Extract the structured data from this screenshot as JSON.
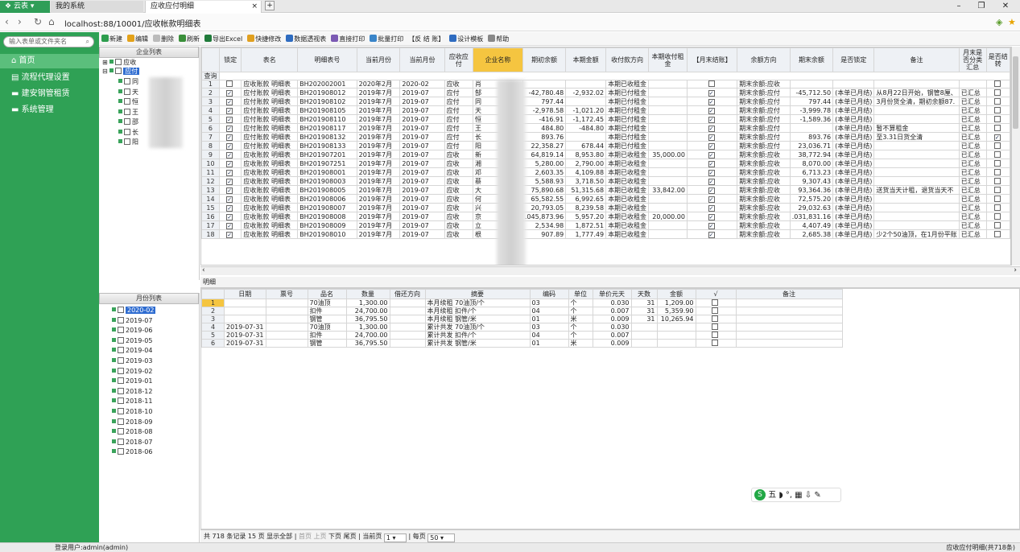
{
  "browser": {
    "tab_app": "云表",
    "tab_system": "我的系统",
    "tab_active": "应收应付明细",
    "url": "localhost:88/10001/应收帐款明细表"
  },
  "sidebar": {
    "search_placeholder": "输入表单或文件夹名",
    "items": [
      {
        "label": "首页"
      },
      {
        "label": "流程代理设置"
      },
      {
        "label": "建安钢管租赁"
      },
      {
        "label": "系统管理"
      }
    ]
  },
  "toolbar": [
    {
      "label": "新建",
      "color": "#2e9e4e"
    },
    {
      "label": "编辑",
      "color": "#e3a21a"
    },
    {
      "label": "删除",
      "color": "#bbbbbb"
    },
    {
      "label": "刷新",
      "color": "#3a8f3a"
    },
    {
      "label": "导出Excel",
      "color": "#1f7a3a"
    },
    {
      "label": "快捷修改",
      "color": "#e0a020"
    },
    {
      "label": "数据透视表",
      "color": "#2f6cc0"
    },
    {
      "label": "直接打印",
      "color": "#7b5ab3"
    },
    {
      "label": "批量打印",
      "color": "#3a85c9"
    },
    {
      "label": "【反 结 账】",
      "color": ""
    },
    {
      "label": "设计模板",
      "color": "#2f6cc0"
    },
    {
      "label": "帮助",
      "color": "#888888"
    }
  ],
  "company_tree": {
    "title": "企业列表",
    "roots": [
      {
        "label": "应收",
        "checked": false
      },
      {
        "label": "应付",
        "checked": false,
        "selected": true
      }
    ],
    "children": [
      "同",
      "天",
      "恒",
      "王",
      "邵",
      "长",
      "阳"
    ]
  },
  "month_list": {
    "title": "月份列表",
    "months": [
      "2020-02",
      "2019-07",
      "2019-06",
      "2019-05",
      "2019-04",
      "2019-03",
      "2019-02",
      "2019-01",
      "2018-12",
      "2018-11",
      "2018-10",
      "2018-09",
      "2018-08",
      "2018-07",
      "2018-06"
    ]
  },
  "grid": {
    "query_label": "查询",
    "columns": [
      "锁定",
      "表名",
      "明细表号",
      "当前月份",
      "当前月份",
      "应收应付",
      "企业名称",
      "期初余额",
      "本期金额",
      "收付款方向",
      "本期收付租金",
      "【月末结账】",
      "余额方向",
      "期末余额",
      "是否锁定",
      "备注",
      "月末是否分类汇总",
      "是否结转"
    ],
    "rows": [
      {
        "n": "1",
        "lock": false,
        "tbl": "应收账款 明细表",
        "no": "BH202002001",
        "m1": "2020年2月",
        "m2": "2020-02",
        "type": "应收",
        "co": "肖",
        "open": "",
        "amt": "",
        "dir": "本期已收租金",
        "rent": "",
        "close": false,
        "bdir": "期末余额:应收",
        "end": "",
        "locked": "",
        "note": "",
        "sum": "",
        "carry": false
      },
      {
        "n": "2",
        "lock": true,
        "tbl": "应付账款 明细表",
        "no": "BH201908012",
        "m1": "2019年7月",
        "m2": "2019-07",
        "type": "应付",
        "co": "郜",
        "open": "-42,780.48",
        "amt": "-2,932.02",
        "dir": "本期已付租金",
        "rent": "",
        "close": true,
        "bdir": "期末余额:应付",
        "end": "-45,712.50",
        "locked": "(本单已月结)",
        "note": "从8月22日开始，钢管8厘、",
        "sum": "已汇总",
        "carry": false
      },
      {
        "n": "3",
        "lock": true,
        "tbl": "应付账款 明细表",
        "no": "BH201908102",
        "m1": "2019年7月",
        "m2": "2019-07",
        "type": "应付",
        "co": "同",
        "open": "797.44",
        "amt": "",
        "dir": "本期已付租金",
        "rent": "",
        "close": true,
        "bdir": "期末余额:应付",
        "end": "797.44",
        "locked": "(本单已月结)",
        "note": "3月份货全清，期初余额87.",
        "sum": "已汇总",
        "carry": false
      },
      {
        "n": "4",
        "lock": true,
        "tbl": "应付账款 明细表",
        "no": "BH201908105",
        "m1": "2019年7月",
        "m2": "2019-07",
        "type": "应付",
        "co": "天",
        "open": "-2,978.58",
        "amt": "-1,021.20",
        "dir": "本期已付租金",
        "rent": "",
        "close": true,
        "bdir": "期末余额:应付",
        "end": "-3,999.78",
        "locked": "(本单已月结)",
        "note": "",
        "sum": "已汇总",
        "carry": false
      },
      {
        "n": "5",
        "lock": true,
        "tbl": "应付账款 明细表",
        "no": "BH201908110",
        "m1": "2019年7月",
        "m2": "2019-07",
        "type": "应付",
        "co": "恒",
        "open": "-416.91",
        "amt": "-1,172.45",
        "dir": "本期已付租金",
        "rent": "",
        "close": true,
        "bdir": "期末余额:应付",
        "end": "-1,589.36",
        "locked": "(本单已月结)",
        "note": "",
        "sum": "已汇总",
        "carry": false
      },
      {
        "n": "6",
        "lock": true,
        "tbl": "应付账款 明细表",
        "no": "BH201908117",
        "m1": "2019年7月",
        "m2": "2019-07",
        "type": "应付",
        "co": "王",
        "open": "484.80",
        "amt": "-484.80",
        "dir": "本期已付租金",
        "rent": "",
        "close": true,
        "bdir": "期末余额:应付",
        "end": "",
        "locked": "(本单已月结)",
        "note": "暂不算租金",
        "sum": "已汇总",
        "carry": false
      },
      {
        "n": "7",
        "lock": true,
        "tbl": "应付账款 明细表",
        "no": "BH201908132",
        "m1": "2019年7月",
        "m2": "2019-07",
        "type": "应付",
        "co": "长",
        "open": "893.76",
        "amt": "",
        "dir": "本期已付租金",
        "rent": "",
        "close": true,
        "bdir": "期末余额:应付",
        "end": "893.76",
        "locked": "(本单已月结)",
        "note": "至3.31日货全清",
        "sum": "已汇总",
        "carry": true
      },
      {
        "n": "8",
        "lock": true,
        "tbl": "应付账款 明细表",
        "no": "BH201908133",
        "m1": "2019年7月",
        "m2": "2019-07",
        "type": "应付",
        "co": "阳",
        "open": "22,358.27",
        "amt": "678.44",
        "dir": "本期已付租金",
        "rent": "",
        "close": true,
        "bdir": "期末余额:应付",
        "end": "23,036.71",
        "locked": "(本单已月结)",
        "note": "",
        "sum": "已汇总",
        "carry": false
      },
      {
        "n": "9",
        "lock": true,
        "tbl": "应收账款 明细表",
        "no": "BH201907201",
        "m1": "2019年7月",
        "m2": "2019-07",
        "type": "应收",
        "co": "新",
        "open": "64,819.14",
        "amt": "8,953.80",
        "dir": "本期已收租金",
        "rent": "35,000.00",
        "close": true,
        "bdir": "期末余额:应收",
        "end": "38,772.94",
        "locked": "(本单已月结)",
        "note": "",
        "sum": "已汇总",
        "carry": false
      },
      {
        "n": "10",
        "lock": true,
        "tbl": "应收账款 明细表",
        "no": "BH201907251",
        "m1": "2019年7月",
        "m2": "2019-07",
        "type": "应收",
        "co": "湘",
        "open": "5,280.00",
        "amt": "2,790.00",
        "dir": "本期已收租金",
        "rent": "",
        "close": true,
        "bdir": "期末余额:应收",
        "end": "8,070.00",
        "locked": "(本单已月结)",
        "note": "",
        "sum": "已汇总",
        "carry": false
      },
      {
        "n": "11",
        "lock": true,
        "tbl": "应收账款 明细表",
        "no": "BH201908001",
        "m1": "2019年7月",
        "m2": "2019-07",
        "type": "应收",
        "co": "邓",
        "open": "2,603.35",
        "amt": "4,109.88",
        "dir": "本期已收租金",
        "rent": "",
        "close": true,
        "bdir": "期末余额:应收",
        "end": "6,713.23",
        "locked": "(本单已月结)",
        "note": "",
        "sum": "已汇总",
        "carry": false
      },
      {
        "n": "12",
        "lock": true,
        "tbl": "应收账款 明细表",
        "no": "BH201908003",
        "m1": "2019年7月",
        "m2": "2019-07",
        "type": "应收",
        "co": "蔡",
        "open": "5,588.93",
        "amt": "3,718.50",
        "dir": "本期已收租金",
        "rent": "",
        "close": true,
        "bdir": "期末余额:应收",
        "end": "9,307.43",
        "locked": "(本单已月结)",
        "note": "",
        "sum": "已汇总",
        "carry": false
      },
      {
        "n": "13",
        "lock": true,
        "tbl": "应收账款 明细表",
        "no": "BH201908005",
        "m1": "2019年7月",
        "m2": "2019-07",
        "type": "应收",
        "co": "大",
        "open": "75,890.68",
        "amt": "51,315.68",
        "dir": "本期已收租金",
        "rent": "33,842.00",
        "close": true,
        "bdir": "期末余额:应收",
        "end": "93,364.36",
        "locked": "(本单已月结)",
        "note": "送货当天计租，退货当天不",
        "sum": "已汇总",
        "carry": false
      },
      {
        "n": "14",
        "lock": true,
        "tbl": "应收账款 明细表",
        "no": "BH201908006",
        "m1": "2019年7月",
        "m2": "2019-07",
        "type": "应收",
        "co": "何",
        "open": "65,582.55",
        "amt": "6,992.65",
        "dir": "本期已收租金",
        "rent": "",
        "close": true,
        "bdir": "期末余额:应收",
        "end": "72,575.20",
        "locked": "(本单已月结)",
        "note": "",
        "sum": "已汇总",
        "carry": false
      },
      {
        "n": "15",
        "lock": true,
        "tbl": "应收账款 明细表",
        "no": "BH201908007",
        "m1": "2019年7月",
        "m2": "2019-07",
        "type": "应收",
        "co": "兴",
        "open": "20,793.05",
        "amt": "8,239.58",
        "dir": "本期已收租金",
        "rent": "",
        "close": true,
        "bdir": "期末余额:应收",
        "end": "29,032.63",
        "locked": "(本单已月结)",
        "note": "",
        "sum": "已汇总",
        "carry": false
      },
      {
        "n": "16",
        "lock": true,
        "tbl": "应收账款 明细表",
        "no": "BH201908008",
        "m1": "2019年7月",
        "m2": "2019-07",
        "type": "应收",
        "co": "京",
        "open": ".045,873.96",
        "amt": "5,957.20",
        "dir": "本期已收租金",
        "rent": "20,000.00",
        "close": true,
        "bdir": "期末余额:应收",
        "end": ".031,831.16",
        "locked": "(本单已月结)",
        "note": "",
        "sum": "已汇总",
        "carry": false
      },
      {
        "n": "17",
        "lock": true,
        "tbl": "应收账款 明细表",
        "no": "BH201908009",
        "m1": "2019年7月",
        "m2": "2019-07",
        "type": "应收",
        "co": "立",
        "open": "2,534.98",
        "amt": "1,872.51",
        "dir": "本期已收租金",
        "rent": "",
        "close": true,
        "bdir": "期末余额:应收",
        "end": "4,407.49",
        "locked": "(本单已月结)",
        "note": "",
        "sum": "已汇总",
        "carry": false
      },
      {
        "n": "18",
        "lock": true,
        "tbl": "应收账款 明细表",
        "no": "BH201908010",
        "m1": "2019年7月",
        "m2": "2019-07",
        "type": "应收",
        "co": "根",
        "open": "907.89",
        "amt": "1,777.49",
        "dir": "本期已收租金",
        "rent": "",
        "close": true,
        "bdir": "期末余额:应收",
        "end": "2,685.38",
        "locked": "(本单已月结)",
        "note": "少2个50油顶，在1月份平账",
        "sum": "已汇总",
        "carry": false
      }
    ]
  },
  "detail": {
    "tab_label": "明细",
    "columns": [
      "日期",
      "票号",
      "品名",
      "数量",
      "借还方向",
      "摘要",
      "编码",
      "单位",
      "单价元天",
      "天数",
      "金额",
      "√",
      "备注"
    ],
    "rows": [
      {
        "n": "1",
        "date": "",
        "ticket": "",
        "name": "70油顶",
        "qty": "1,300.00",
        "dirn": "",
        "memo": "本月续租 70油顶/个",
        "code": "03",
        "unit": "个",
        "price": "0.030",
        "days": "31",
        "amt": "1,209.00",
        "chk": false,
        "note": ""
      },
      {
        "n": "2",
        "date": "",
        "ticket": "",
        "name": "扣件",
        "qty": "24,700.00",
        "dirn": "",
        "memo": "本月续租 扣件/个",
        "code": "04",
        "unit": "个",
        "price": "0.007",
        "days": "31",
        "amt": "5,359.90",
        "chk": false,
        "note": ""
      },
      {
        "n": "3",
        "date": "",
        "ticket": "",
        "name": "钢管",
        "qty": "36,795.50",
        "dirn": "",
        "memo": "本月续租 钢管/米",
        "code": "01",
        "unit": "米",
        "price": "0.009",
        "days": "31",
        "amt": "10,265.94",
        "chk": false,
        "note": ""
      },
      {
        "n": "4",
        "date": "2019-07-31",
        "ticket": "",
        "name": "70油顶",
        "qty": "1,300.00",
        "dirn": "",
        "memo": "累计共发 70油顶/个",
        "code": "03",
        "unit": "个",
        "price": "0.030",
        "days": "",
        "amt": "",
        "chk": false,
        "note": ""
      },
      {
        "n": "5",
        "date": "2019-07-31",
        "ticket": "",
        "name": "扣件",
        "qty": "24,700.00",
        "dirn": "",
        "memo": "累计共发 扣件/个",
        "code": "04",
        "unit": "个",
        "price": "0.007",
        "days": "",
        "amt": "",
        "chk": false,
        "note": ""
      },
      {
        "n": "6",
        "date": "2019-07-31",
        "ticket": "",
        "name": "钢管",
        "qty": "36,795.50",
        "dirn": "",
        "memo": "累计共发 钢管/米",
        "code": "01",
        "unit": "米",
        "price": "0.009",
        "days": "",
        "amt": "",
        "chk": false,
        "note": ""
      }
    ]
  },
  "pager": {
    "text": "共 718 条记录 15 页 显示全部",
    "first": "首页",
    "prev": "上页",
    "next": "下页",
    "last": "尾页",
    "current_label": "当前页",
    "current": "1",
    "per_page_label": "每页",
    "per_page": "50"
  },
  "ime": {
    "logo": "S",
    "text": "五 ◗ °, ▦ ⇩ ✎"
  },
  "status": {
    "user": "登录用户:admin(admin)",
    "right": "应收应付明细(共718条)"
  }
}
